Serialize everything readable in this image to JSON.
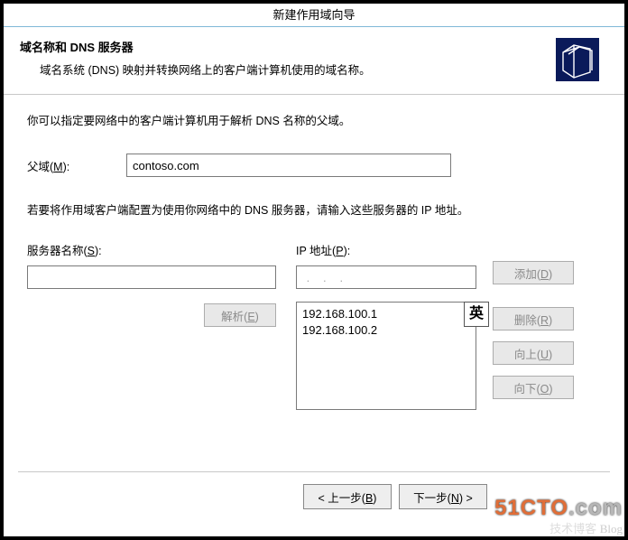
{
  "titlebar": "新建作用域向导",
  "header": {
    "title": "域名称和 DNS 服务器",
    "subtitle": "域名系统 (DNS) 映射并转换网络上的客户端计算机使用的域名称。"
  },
  "body": {
    "intro": "你可以指定要网络中的客户端计算机用于解析 DNS 名称的父域。",
    "parent_label_pre": "父域(",
    "parent_label_key": "M",
    "parent_label_post": "):",
    "parent_value": "contoso.com",
    "note2": "若要将作用域客户端配置为使用你网络中的 DNS 服务器，请输入这些服务器的 IP 地址。",
    "server_name_lbl_pre": "服务器名称(",
    "server_name_lbl_key": "S",
    "server_name_lbl_post": "):",
    "server_name_value": "",
    "ip_lbl_pre": "IP 地址(",
    "ip_lbl_key": "P",
    "ip_lbl_post": "):",
    "ip_value": " .   .   . ",
    "ip_list": [
      "192.168.100.1",
      "192.168.100.2"
    ],
    "resolve_btn_pre": "解析(",
    "resolve_btn_key": "E",
    "resolve_btn_post": ")",
    "add_btn_pre": "添加(",
    "add_btn_key": "D",
    "add_btn_post": ")",
    "del_btn_pre": "删除(",
    "del_btn_key": "R",
    "del_btn_post": ")",
    "up_btn_pre": "向上(",
    "up_btn_key": "U",
    "up_btn_post": ")",
    "down_btn_pre": "向下(",
    "down_btn_key": "O",
    "down_btn_post": ")"
  },
  "ime": "英",
  "footer": {
    "back_pre": "< 上一步(",
    "back_key": "B",
    "back_post": ")",
    "next_pre": "下一步(",
    "next_key": "N",
    "next_post": ") >"
  },
  "watermark": {
    "site_a": "51CTO",
    "site_b": ".com",
    "sub": "技术博客",
    "blog": "Blog"
  }
}
